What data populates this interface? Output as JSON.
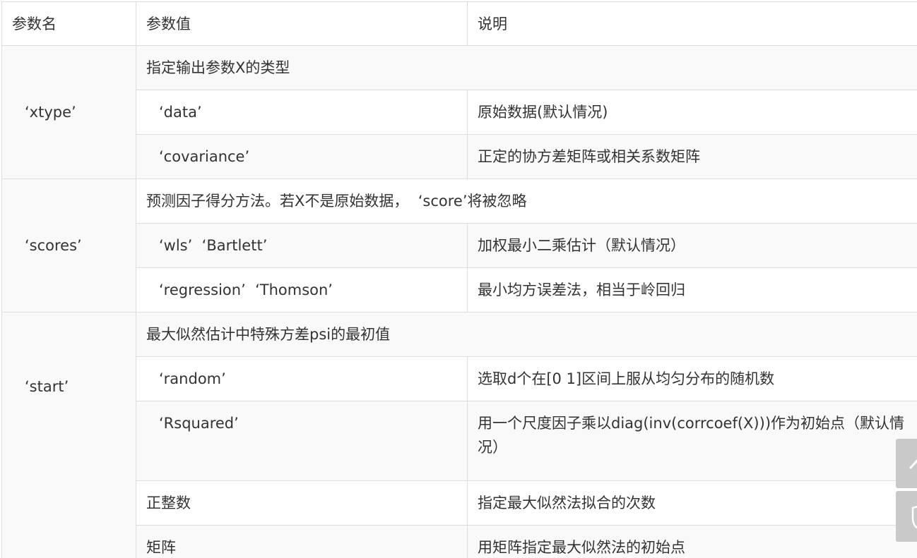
{
  "headers": {
    "name": "参数名",
    "value": "参数值",
    "desc": "说明"
  },
  "xtype": {
    "name": "‘xtype’",
    "summary": "指定输出参数X的类型",
    "rows": [
      {
        "value": "‘data’",
        "desc": "原始数据(默认情况)"
      },
      {
        "value": "‘covariance’",
        "desc": "正定的协方差矩阵或相关系数矩阵"
      }
    ]
  },
  "scores": {
    "name": "‘scores’",
    "summary": "预测因子得分方法。若X不是原始数据，  ‘score’将被忽略",
    "rows": [
      {
        "value": "‘wls’  ‘Bartlett’",
        "desc": "加权最小二乘估计（默认情况）"
      },
      {
        "value": "‘regression’  ‘Thomson’",
        "desc": "最小均方误差法，相当于岭回归"
      }
    ]
  },
  "start": {
    "name": "‘start’",
    "summary": "最大似然估计中特殊方差psi的最初值",
    "rows": [
      {
        "value": "‘random’",
        "desc": "选取d个在[0 1]区间上服从均匀分布的随机数"
      },
      {
        "value": "‘Rsquared’",
        "desc": "用一个尺度因子乘以diag(inv(corrcoef(X)))作为初始点（默认情况）"
      },
      {
        "value": "正整数",
        "desc": "指定最大似然法拟合的次数"
      },
      {
        "value": "矩阵",
        "desc": "用矩阵指定最大似然法的初始点"
      }
    ]
  },
  "side_buttons": {
    "up": "chevron-up-icon",
    "second": "shield-icon"
  }
}
